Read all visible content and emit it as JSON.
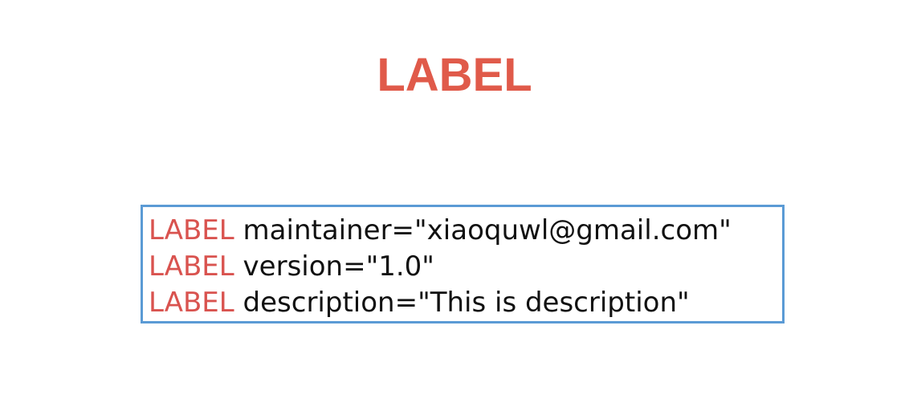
{
  "title": "LABEL",
  "colors": {
    "title": "#e05a4a",
    "keyword": "#d9534f",
    "text": "#111111",
    "box_border": "#5b9bd5"
  },
  "code": {
    "lines": [
      {
        "keyword": "LABEL",
        "rest": "maintainer=\"xiaoquwl@gmail.com\""
      },
      {
        "keyword": "LABEL",
        "rest": "version=\"1.0\""
      },
      {
        "keyword": "LABEL",
        "rest": "description=\"This is description\""
      }
    ]
  }
}
